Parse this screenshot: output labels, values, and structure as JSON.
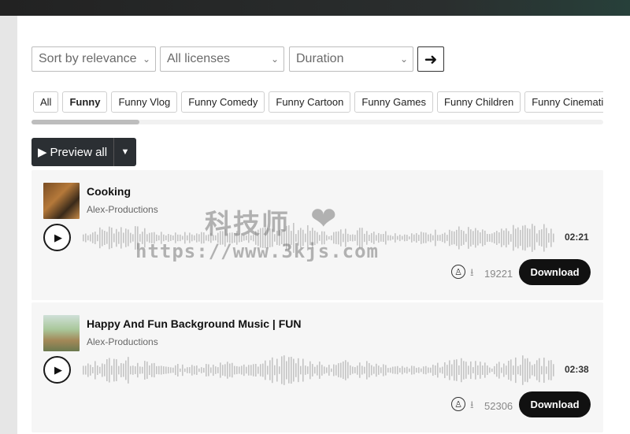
{
  "filters": {
    "sort": "Sort by relevance",
    "license": "All licenses",
    "duration": "Duration",
    "go_icon": "arrow-right-icon"
  },
  "tags": [
    "All",
    "Funny",
    "Funny Vlog",
    "Funny Comedy",
    "Funny Cartoon",
    "Funny Games",
    "Funny Children",
    "Funny Cinematic"
  ],
  "active_tag": "Funny",
  "tag_scroll_position": 0.15,
  "preview": {
    "label": "Preview all"
  },
  "tracks": [
    {
      "title": "Cooking",
      "artist": "Alex-Productions",
      "duration": "02:21",
      "downloads": "19221",
      "download_label": "Download"
    },
    {
      "title": "Happy And Fun Background Music | FUN",
      "artist": "Alex-Productions",
      "duration": "02:38",
      "downloads": "52306",
      "download_label": "Download"
    }
  ],
  "watermark": {
    "text": "科技师",
    "url": "https://www.3kjs.com"
  },
  "colors": {
    "accent": "#111111",
    "preview_bg": "#2b2f33",
    "card_bg": "#f6f6f6",
    "wave": "#c4c4c4"
  }
}
